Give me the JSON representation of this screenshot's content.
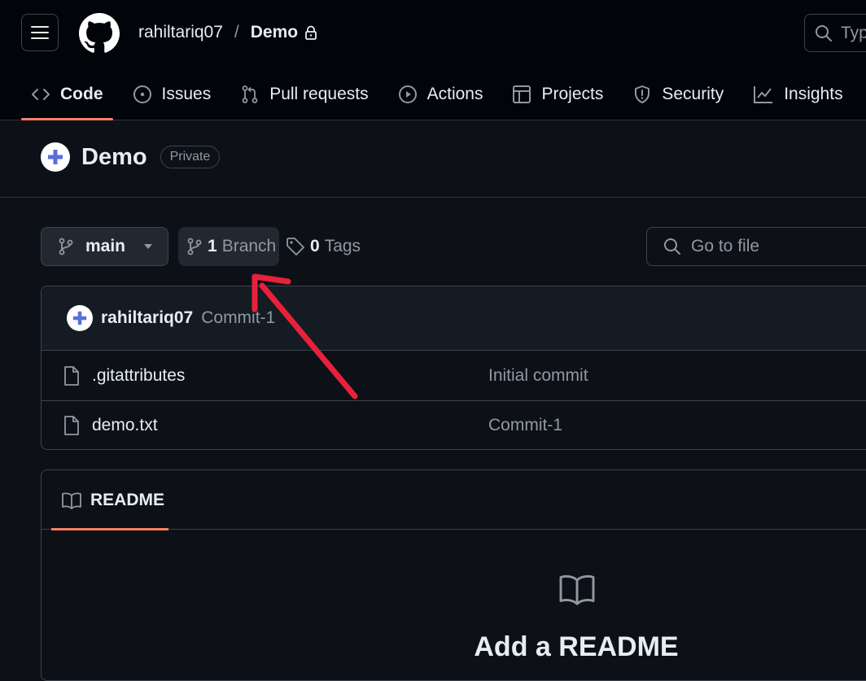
{
  "header": {
    "owner": "rahiltariq07",
    "separator": "/",
    "repo": "Demo",
    "search_placeholder": "Type"
  },
  "tabs": [
    {
      "label": "Code",
      "icon": "code-icon",
      "active": true
    },
    {
      "label": "Issues",
      "icon": "issue-icon"
    },
    {
      "label": "Pull requests",
      "icon": "pull-request-icon"
    },
    {
      "label": "Actions",
      "icon": "play-icon"
    },
    {
      "label": "Projects",
      "icon": "table-icon"
    },
    {
      "label": "Security",
      "icon": "shield-icon"
    },
    {
      "label": "Insights",
      "icon": "graph-icon"
    }
  ],
  "repo": {
    "name": "Demo",
    "visibility": "Private"
  },
  "toolbar": {
    "branch": "main",
    "branch_count": "1",
    "branch_label": "Branch",
    "tag_count": "0",
    "tag_label": "Tags",
    "file_search_placeholder": "Go to file"
  },
  "commit": {
    "author": "rahiltariq07",
    "message": "Commit-1"
  },
  "files": [
    {
      "name": ".gitattributes",
      "message": "Initial commit"
    },
    {
      "name": "demo.txt",
      "message": "Commit-1"
    }
  ],
  "readme": {
    "tab_label": "README",
    "title": "Add a README"
  },
  "colors": {
    "background": "#0d1117",
    "header": "#010409",
    "accent_underline": "#f78166",
    "annotation_arrow": "#e8213a"
  }
}
